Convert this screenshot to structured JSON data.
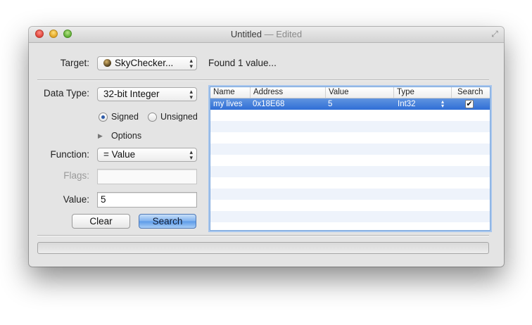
{
  "window": {
    "title": "Untitled",
    "title_suffix": "— Edited"
  },
  "target": {
    "label": "Target:",
    "value": "SkyChecker...",
    "status": "Found 1 value..."
  },
  "data_type": {
    "label": "Data Type:",
    "value": "32-bit Integer"
  },
  "signedness": {
    "signed_label": "Signed",
    "unsigned_label": "Unsigned",
    "selected": "Signed"
  },
  "options": {
    "label": "Options"
  },
  "function": {
    "label": "Function:",
    "value": "= Value"
  },
  "flags": {
    "label": "Flags:",
    "value": ""
  },
  "value": {
    "label": "Value:",
    "value": "5"
  },
  "buttons": {
    "clear": "Clear",
    "search": "Search"
  },
  "table": {
    "columns": [
      "Name",
      "Address",
      "Value",
      "Type",
      "Search"
    ],
    "rows": [
      {
        "name": "my lives",
        "address": "0x18E68",
        "value": "5",
        "type": "Int32",
        "search": true
      }
    ]
  },
  "progress": {
    "value": 0
  },
  "colors": {
    "selection": "#2f6ed6",
    "default_button": "#5b9ae8"
  },
  "icons": [
    "close-icon",
    "minimize-icon",
    "zoom-icon",
    "fullscreen-icon",
    "app-icon",
    "disclosure-triangle-icon",
    "checkmark-icon"
  ]
}
